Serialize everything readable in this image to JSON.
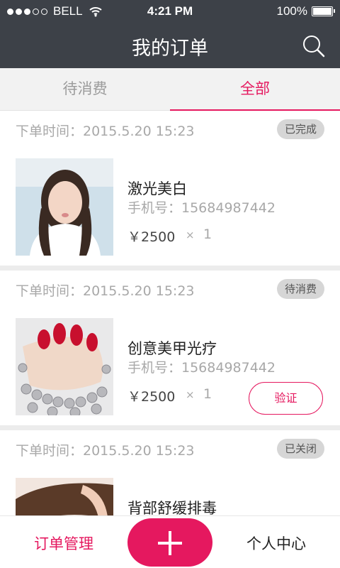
{
  "status_bar": {
    "carrier": "BELL",
    "time": "4:21 PM",
    "battery": "100%"
  },
  "nav": {
    "title": "我的订单",
    "search_icon": "search-icon"
  },
  "tabs": [
    {
      "label": "待消费",
      "active": false
    },
    {
      "label": "全部",
      "active": true
    }
  ],
  "orders": [
    {
      "time": "下单时间：2015.5.20   15:23",
      "status": "已完成",
      "name": "激光美白",
      "phone": "手机号：15684987442",
      "price": "￥2500",
      "times_sign": "×",
      "qty": "1",
      "action": ""
    },
    {
      "time": "下单时间：2015.5.20   15:23",
      "status": "待消费",
      "name": "创意美甲光疗",
      "phone": "手机号：15684987442",
      "price": "￥2500",
      "times_sign": "×",
      "qty": "1",
      "action": "验证"
    },
    {
      "time": "下单时间：2015.5.20   15:23",
      "status": "已关闭",
      "name": "背部舒缓排毒",
      "phone": "",
      "price": "",
      "times_sign": "",
      "qty": "",
      "action": ""
    }
  ],
  "bottom_bar": {
    "left_label": "订单管理",
    "right_label": "个人中心",
    "center_icon": "plus-icon"
  },
  "colors": {
    "accent": "#e5185f",
    "header": "#3d4148"
  }
}
